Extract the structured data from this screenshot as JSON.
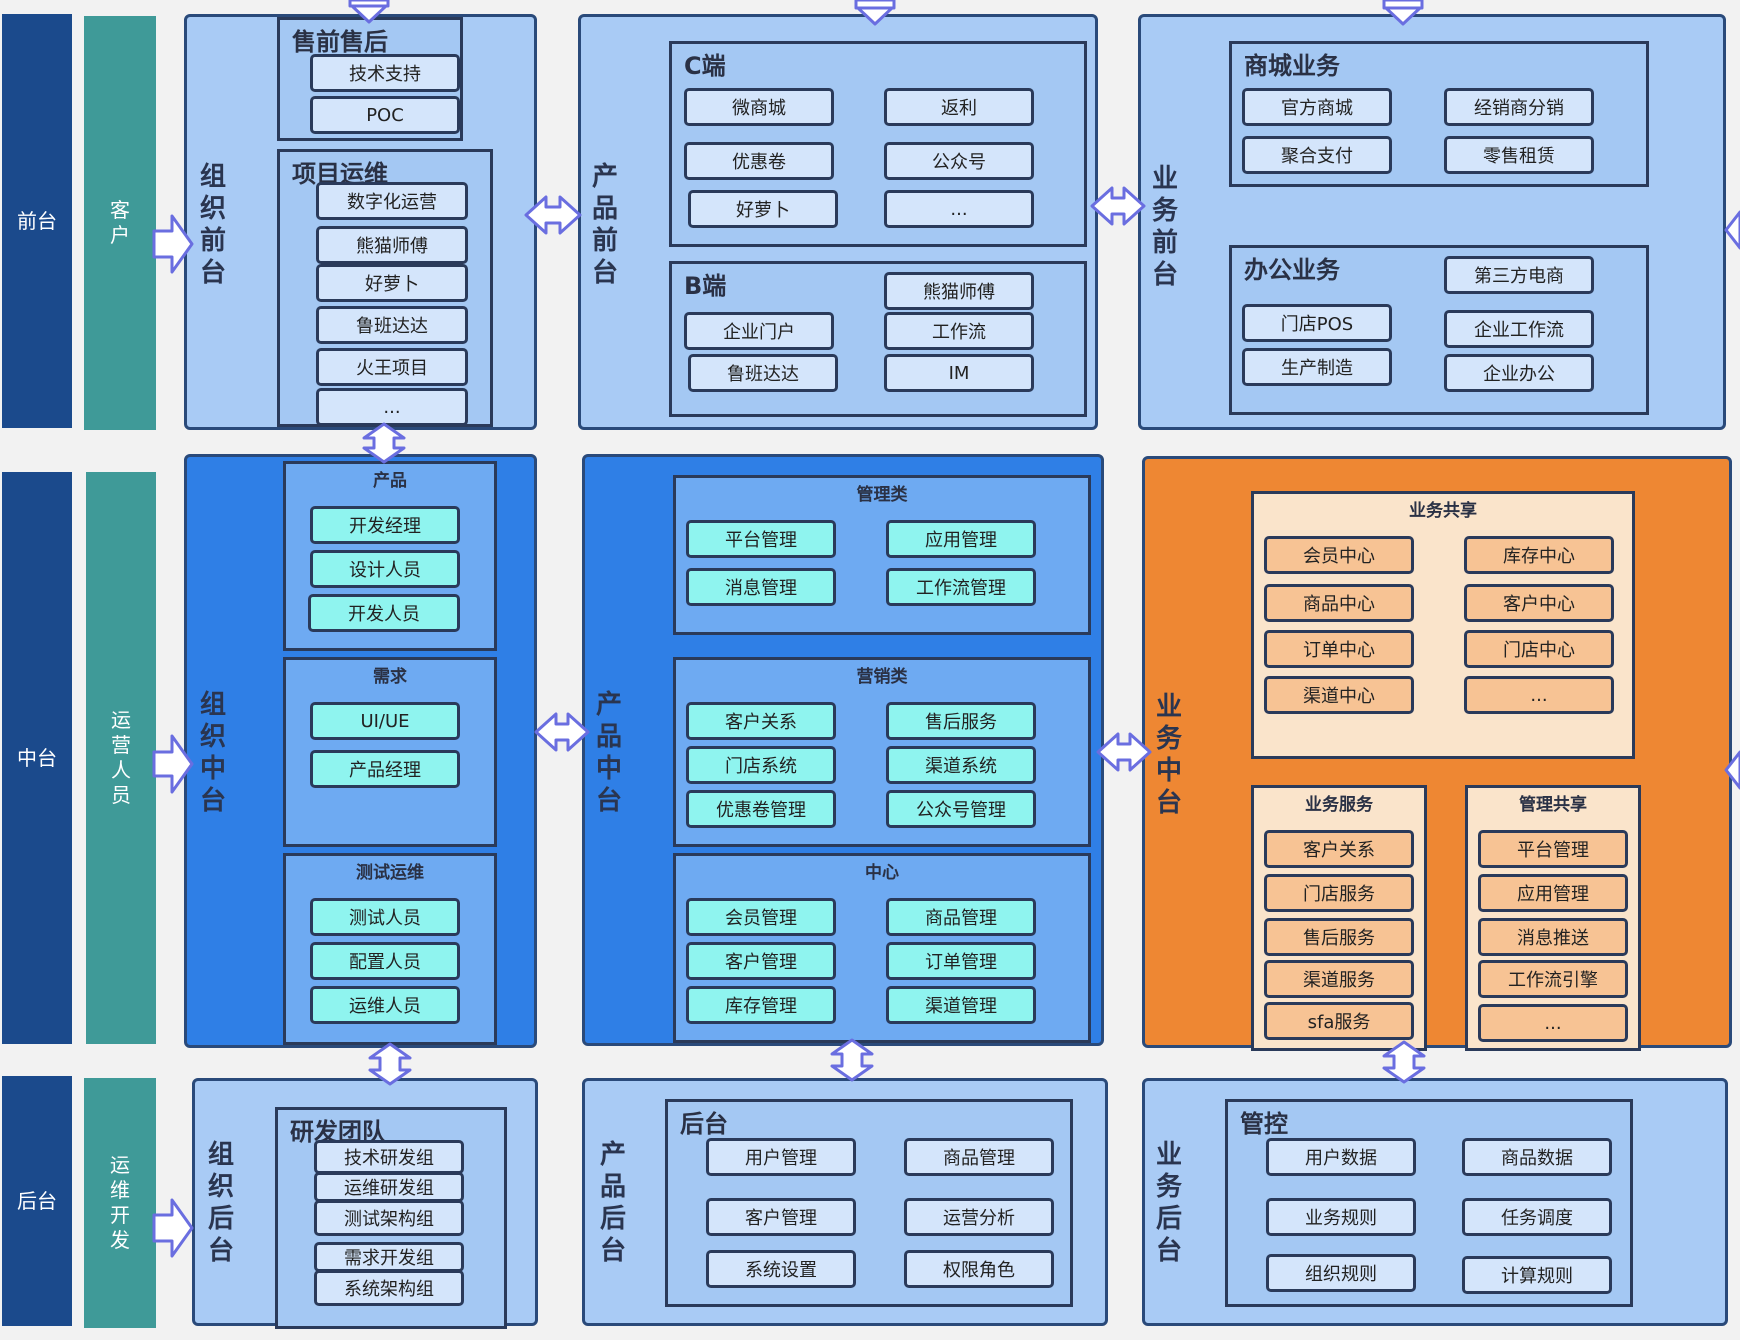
{
  "bands": {
    "front": "前台",
    "middle": "中台",
    "back": "后台",
    "front_role": "客户",
    "middle_role": "运营人员",
    "back_role": "运维开发"
  },
  "panels": {
    "org_front": "组织前台",
    "prod_front": "产品前台",
    "biz_front": "业务前台",
    "org_middle": "组织中台",
    "prod_middle": "产品中台",
    "biz_middle": "业务中台",
    "org_back": "组织后台",
    "prod_back": "产品后台",
    "biz_back": "业务后台"
  },
  "org_front": {
    "presale": {
      "title": "售前售后",
      "items": [
        "技术支持",
        "POC"
      ]
    },
    "ops": {
      "title": "项目运维",
      "items": [
        "数字化运营",
        "熊猫师傅",
        "好萝卜",
        "鲁班达达",
        "火王项目",
        "..."
      ]
    }
  },
  "prod_front": {
    "c_side": {
      "title": "C端",
      "items": [
        "微商城",
        "返利",
        "优惠卷",
        "公众号",
        "好萝卜",
        "..."
      ]
    },
    "b_side": {
      "title": "B端",
      "items": [
        "熊猫师傅",
        "企业门户",
        "工作流",
        "鲁班达达",
        "IM"
      ]
    }
  },
  "biz_front": {
    "mall": {
      "title": "商城业务",
      "items": [
        "官方商城",
        "经销商分销",
        "聚合支付",
        "零售租赁"
      ]
    },
    "office": {
      "title": "办公业务",
      "items": [
        "第三方电商",
        "门店POS",
        "企业工作流",
        "生产制造",
        "企业办公"
      ]
    }
  },
  "org_middle": {
    "product": {
      "title": "产品",
      "items": [
        "开发经理",
        "设计人员",
        "开发人员"
      ]
    },
    "demand": {
      "title": "需求",
      "items": [
        "UI/UE",
        "产品经理"
      ]
    },
    "testops": {
      "title": "测试运维",
      "items": [
        "测试人员",
        "配置人员",
        "运维人员"
      ]
    }
  },
  "prod_middle": {
    "mgmt": {
      "title": "管理类",
      "items": [
        "平台管理",
        "应用管理",
        "消息管理",
        "工作流管理"
      ]
    },
    "marketing": {
      "title": "营销类",
      "items": [
        "客户关系",
        "售后服务",
        "门店系统",
        "渠道系统",
        "优惠卷管理",
        "公众号管理"
      ]
    },
    "center": {
      "title": "中心",
      "items": [
        "会员管理",
        "商品管理",
        "客户管理",
        "订单管理",
        "库存管理",
        "渠道管理"
      ]
    }
  },
  "biz_middle": {
    "shared": {
      "title": "业务共享",
      "items": [
        "会员中心",
        "库存中心",
        "商品中心",
        "客户中心",
        "订单中心",
        "门店中心",
        "渠道中心",
        "..."
      ]
    },
    "service": {
      "title": "业务服务",
      "items": [
        "客户关系",
        "门店服务",
        "售后服务",
        "渠道服务",
        "sfa服务"
      ]
    },
    "mgmt_shared": {
      "title": "管理共享",
      "items": [
        "平台管理",
        "应用管理",
        "消息推送",
        "工作流引擎",
        "..."
      ]
    }
  },
  "org_back": {
    "team": {
      "title": "研发团队",
      "items": [
        "技术研发组",
        "运维研发组",
        "测试架构组",
        "需求开发组",
        "系统架构组"
      ]
    }
  },
  "prod_back": {
    "back": {
      "title": "后台",
      "items": [
        "用户管理",
        "商品管理",
        "客户管理",
        "运营分析",
        "系统设置",
        "权限角色"
      ]
    }
  },
  "biz_back": {
    "control": {
      "title": "管控",
      "items": [
        "用户数据",
        "商品数据",
        "业务规则",
        "任务调度",
        "组织规则",
        "计算规则"
      ]
    }
  },
  "colors": {
    "band_dark": "#1b4a8c",
    "band_teal": "#3f9a98",
    "panel_light": "#a9cbf5",
    "panel_blue": "#2f7fe6",
    "panel_orange": "#ee8733",
    "item_cyan": "#8ff4ef",
    "item_peach": "#f7c394",
    "arrow_fill": "#ffffff",
    "arrow_stroke": "#6a6ee0"
  }
}
